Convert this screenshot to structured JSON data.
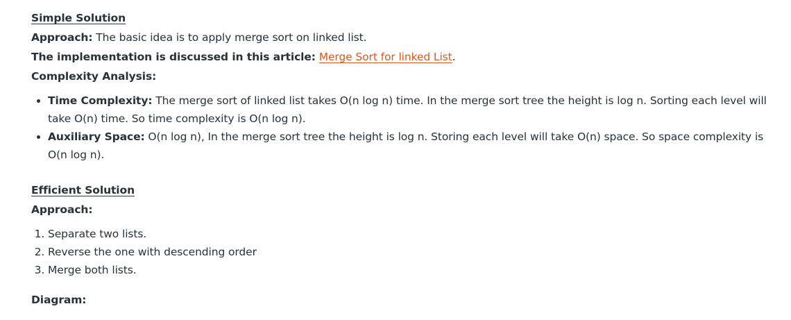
{
  "simple": {
    "heading": "Simple Solution",
    "approach_label": "Approach:",
    "approach_text": " The basic idea is to apply merge sort on linked list.",
    "impl_label": "The implementation is discussed in this article:",
    "impl_link": "Merge Sort for linked List",
    "impl_suffix": ".",
    "complexity_label": "Complexity Analysis:",
    "bullets": [
      {
        "label": "Time Complexity:",
        "text": " The merge sort of linked list takes O(n log n) time. In the merge sort tree the height is log n. Sorting each level will take O(n) time. So time complexity is O(n log n)."
      },
      {
        "label": "Auxiliary Space:",
        "text": " O(n log n), In the merge sort tree the height is log n. Storing each level will take O(n) space. So space complexity is O(n log n)."
      }
    ]
  },
  "efficient": {
    "heading": "Efficient Solution",
    "approach_label": "Approach:",
    "steps": [
      "Separate two lists.",
      "Reverse the one with descending order",
      "Merge both lists."
    ]
  },
  "diagram_label": "Diagram:",
  "colors": {
    "text": "#273239",
    "link": "#e2571b"
  }
}
